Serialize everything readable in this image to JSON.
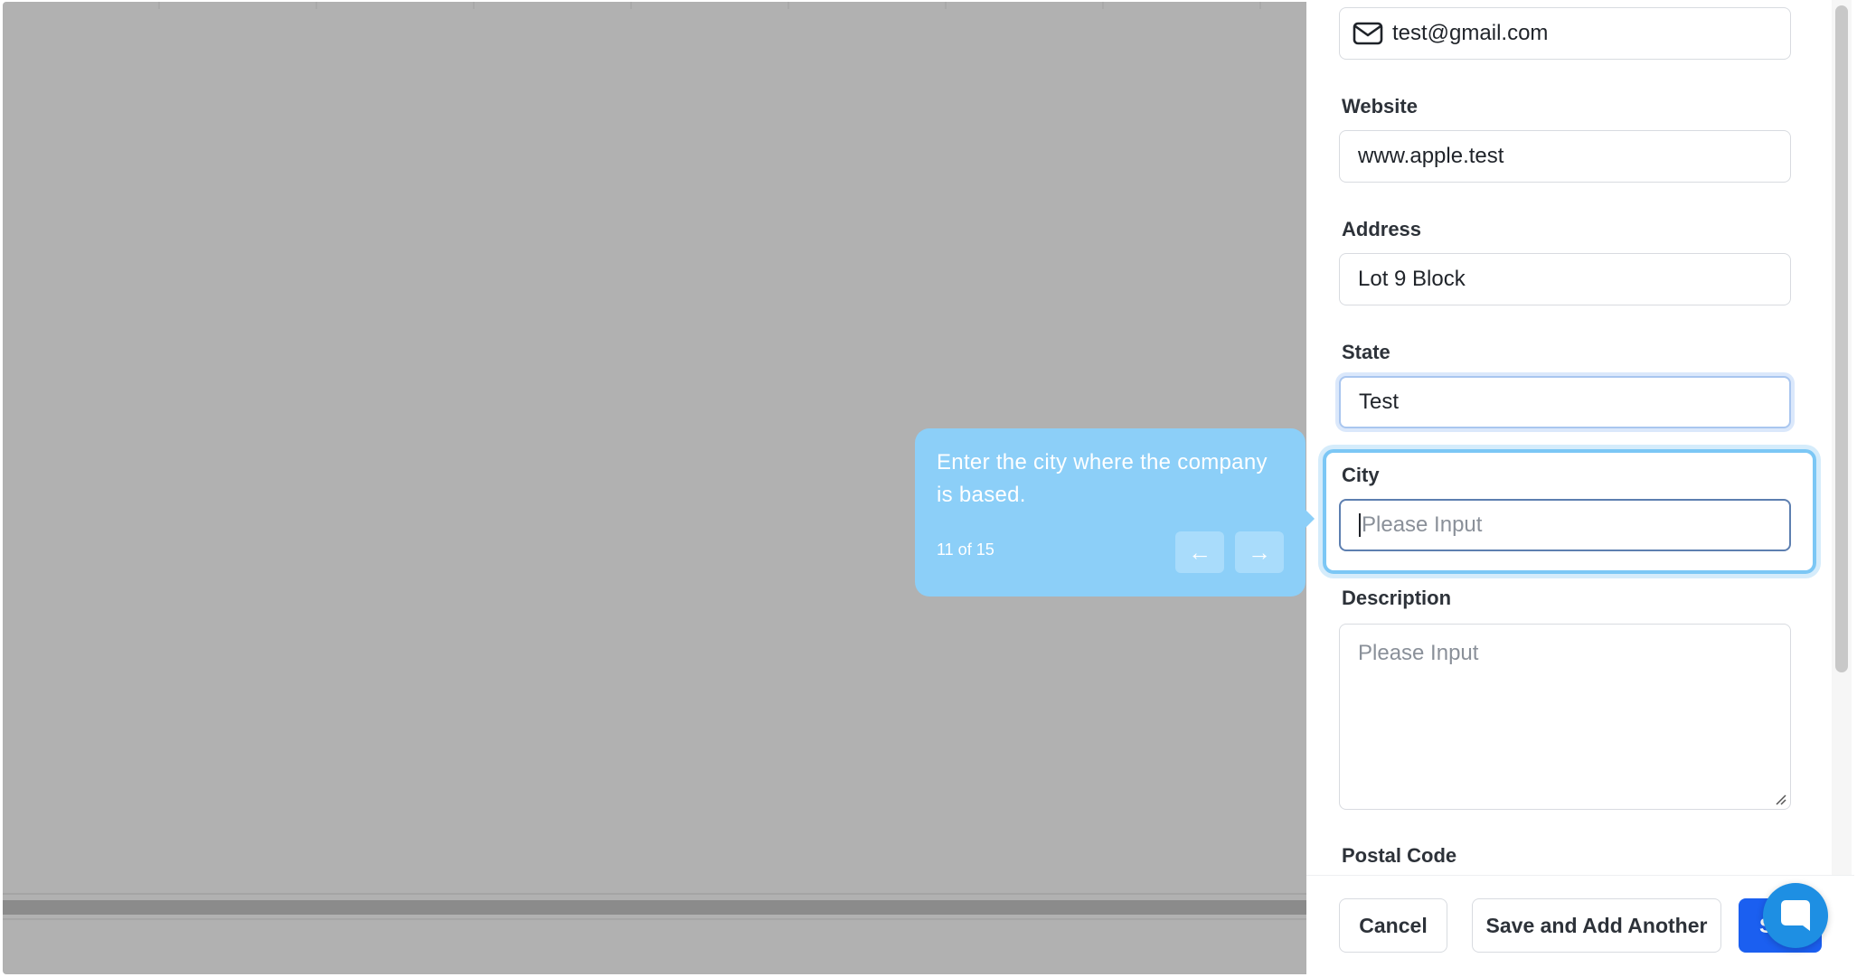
{
  "form": {
    "email_value": "test@gmail.com",
    "website_label": "Website",
    "website_value": "www.apple.test",
    "address_label": "Address",
    "address_value": "Lot 9 Block",
    "state_label": "State",
    "state_value": "Test",
    "city_label": "City",
    "city_placeholder": "Please Input",
    "description_label": "Description",
    "description_placeholder": "Please Input",
    "postal_code_label": "Postal Code"
  },
  "tour": {
    "text": "Enter the city where the company is based.",
    "step": "11 of 15",
    "prev_glyph": "←",
    "next_glyph": "→"
  },
  "footer": {
    "cancel_label": "Cancel",
    "save_another_label": "Save and Add Another",
    "save_label": "Save"
  },
  "icons": {
    "email": "mail-icon",
    "chat": "chat-icon"
  },
  "colors": {
    "primary": "#1b5ff0",
    "tour_bg": "#8ccff8",
    "highlight": "#7cc7f5",
    "chat": "#1e8fe3"
  }
}
